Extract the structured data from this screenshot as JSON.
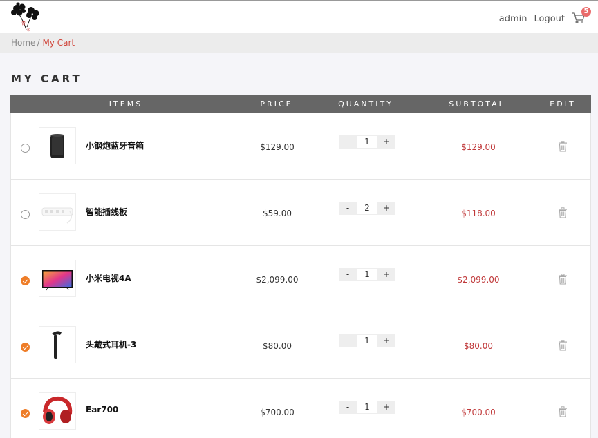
{
  "header": {
    "user": "admin",
    "logout": "Logout",
    "cart_count": "5"
  },
  "breadcrumb": {
    "home": "Home",
    "separator": "/",
    "current": "My Cart"
  },
  "page_title": "MY CART",
  "table": {
    "headers": {
      "items": "ITEMS",
      "price": "PRICE",
      "quantity": "QUANTITY",
      "subtotal": "SUBTOTAL",
      "edit": "EDIT"
    },
    "rows": [
      {
        "name": "小钢炮蓝牙音箱",
        "price": "$129.00",
        "qty": "1",
        "subtotal": "$129.00",
        "checked": false,
        "icon": "speaker-icon"
      },
      {
        "name": "智能插线板",
        "price": "$59.00",
        "qty": "2",
        "subtotal": "$118.00",
        "checked": false,
        "icon": "power-strip-icon"
      },
      {
        "name": "小米电视4A",
        "price": "$2,099.00",
        "qty": "1",
        "subtotal": "$2,099.00",
        "checked": true,
        "icon": "tv-icon"
      },
      {
        "name": "头戴式耳机-3",
        "price": "$80.00",
        "qty": "1",
        "subtotal": "$80.00",
        "checked": true,
        "icon": "earpiece-icon"
      },
      {
        "name": "Ear700",
        "price": "$700.00",
        "qty": "1",
        "subtotal": "$700.00",
        "checked": true,
        "icon": "headphones-icon"
      }
    ],
    "minus": "-",
    "plus": "+"
  },
  "colors": {
    "accent": "#ee7d28",
    "price_red": "#c0393a",
    "header_bg": "#666666",
    "badge": "#e96a6a"
  }
}
